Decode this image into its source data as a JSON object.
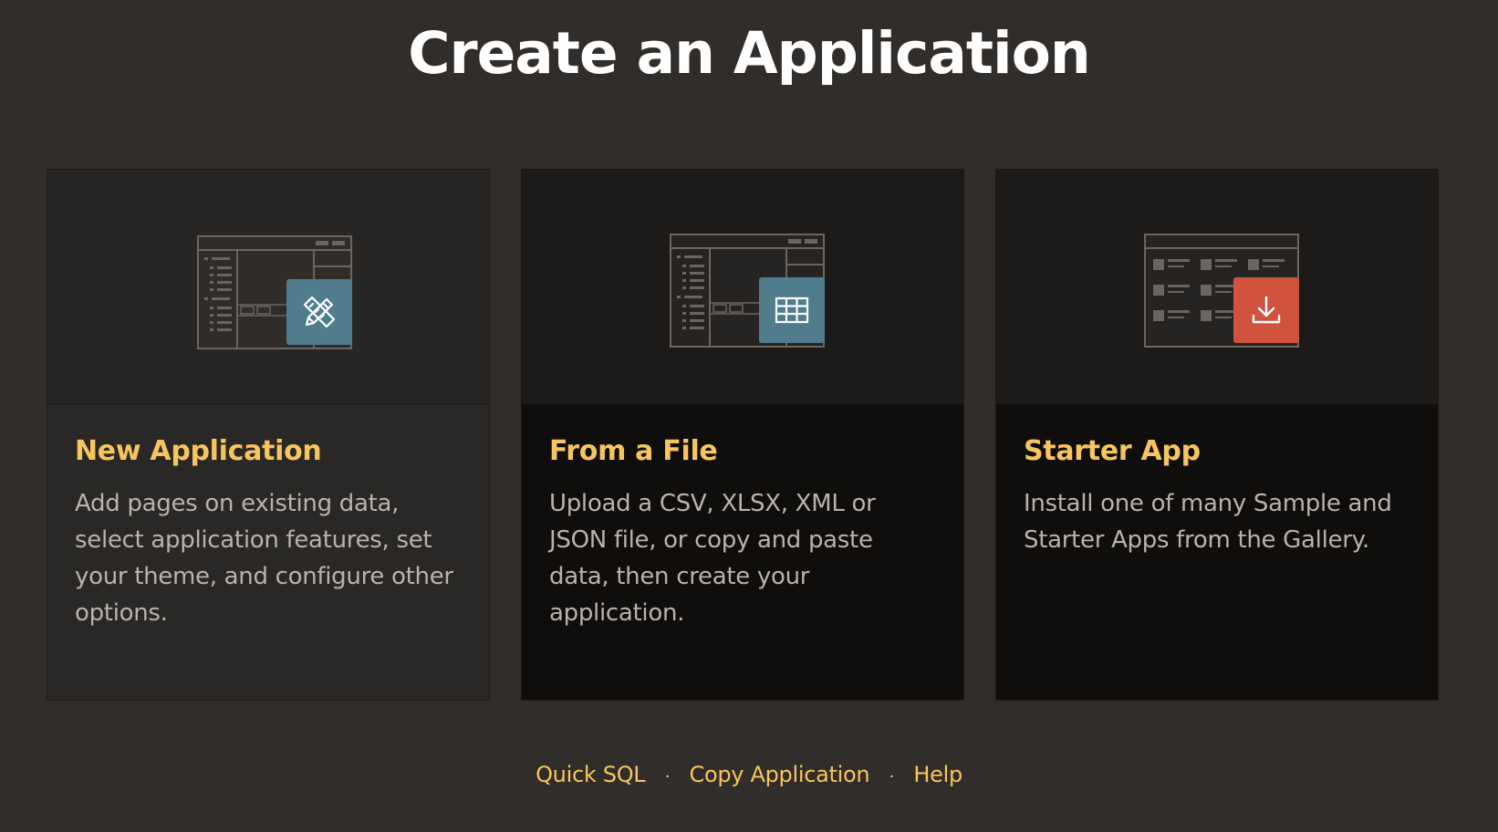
{
  "page": {
    "title": "Create an Application"
  },
  "cards": [
    {
      "title": "New Application",
      "description": "Add pages on existing data, select application features, set your theme, and configure other options.",
      "badge_icon": "pencil-ruler-icon",
      "badge_color": "#4f7d8d"
    },
    {
      "title": "From a File",
      "description": "Upload a CSV, XLSX, XML or JSON file, or copy and paste data, then create your application.",
      "badge_icon": "table-grid-icon",
      "badge_color": "#4f7d8d"
    },
    {
      "title": "Starter App",
      "description": "Install one of many Sample and Starter Apps from the Gallery.",
      "badge_icon": "download-icon",
      "badge_color": "#d1523d"
    }
  ],
  "footer": {
    "links": [
      "Quick SQL",
      "Copy Application",
      "Help"
    ],
    "separator": "·"
  },
  "colors": {
    "background": "#312d2a",
    "accent": "#f7c55f",
    "description_text": "#b7b3ad"
  }
}
